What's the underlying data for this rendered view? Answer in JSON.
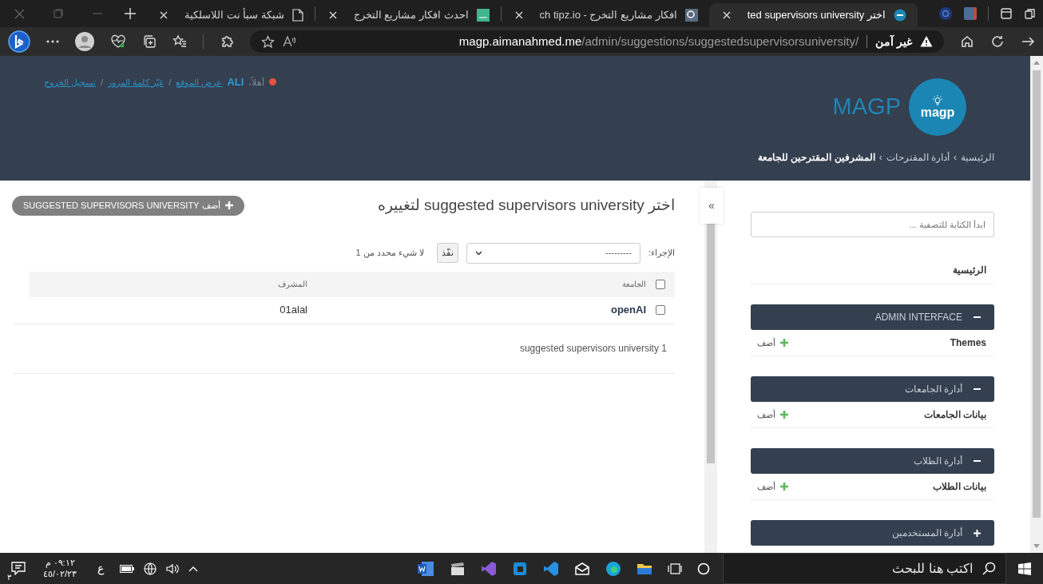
{
  "browser": {
    "tabs": [
      {
        "title": "اختر ted supervisors university",
        "selected": true
      },
      {
        "title": "افكار مشاريع التخرج - ch tipz.io",
        "selected": false
      },
      {
        "title": "احدث افكار مشاريع التخرج",
        "selected": false
      },
      {
        "title": "شبكة سبأ نت اللاسلكية",
        "selected": false
      }
    ],
    "security_label": "غير آمن",
    "url": "**magp.aimanahmed.me**/admin/suggestions/suggestedsupervisorsuniversity/"
  },
  "header": {
    "user_tools": {
      "greeting": "أهلاً،",
      "username": "ALI",
      "links": [
        {
          "label": "عرض الموقع",
          "kind": "link"
        },
        {
          "label": "/",
          "kind": "separator"
        },
        {
          "label": "غيّر كلمة المرور",
          "kind": "link"
        },
        {
          "label": "/",
          "kind": "separator"
        },
        {
          "label": "تسجيل الخروج",
          "kind": "link"
        }
      ]
    },
    "site_name": "MAGP",
    "logo_text": "magp",
    "breadcrumbs": [
      {
        "label": "الرئيسية",
        "kind": "link"
      },
      {
        "label": "›",
        "kind": "separator"
      },
      {
        "label": "أدارة المقترحات",
        "kind": "link"
      },
      {
        "label": "›",
        "kind": "separator"
      },
      {
        "label": "المشرفين المقترحين للجامعة",
        "kind": "current"
      }
    ]
  },
  "main": {
    "title": "اختر suggested supervisors university لتغييره",
    "add_button": "أضف SUGGESTED SUPERVISORS UNIVERSITY",
    "actions": {
      "label": "الإجراء:",
      "select_value": "---------",
      "go_button": "نفّذ",
      "selection_count": "لا شيء محدد من 1"
    },
    "table": {
      "columns": [
        "الجامعة",
        "المشرف"
      ],
      "header_checked": false,
      "rows": [
        {
          "cells": [
            "openAI",
            "01alal"
          ],
          "checked": false
        }
      ]
    },
    "result_count": "1 suggested supervisors university"
  },
  "sidebar": {
    "toggle": "»",
    "filter_placeholder": "ابدأ الكتابة للتصفية ...",
    "home_link": "الرئيسية",
    "groups": [
      {
        "title": "ADMIN INTERFACE",
        "expanded": true,
        "items": [
          {
            "label": "Themes",
            "add_label": "أضف"
          }
        ]
      },
      {
        "title": "أدارة الجامعات",
        "expanded": true,
        "items": [
          {
            "label": "بيانات الجامعات",
            "add_label": "أضف"
          }
        ]
      },
      {
        "title": "أدارة الطلاب",
        "expanded": true,
        "items": [
          {
            "label": "بيانات الطلاب",
            "add_label": "أضف"
          }
        ]
      },
      {
        "title": "أدارة المستخدمين",
        "expanded": false
      }
    ]
  },
  "taskbar": {
    "search_placeholder": "اكتب هنا للبحث",
    "language": "ع",
    "time": "٠٩:١٢ م",
    "date": "٤٥/٠٢/٢٣",
    "notification_count": "٣"
  }
}
